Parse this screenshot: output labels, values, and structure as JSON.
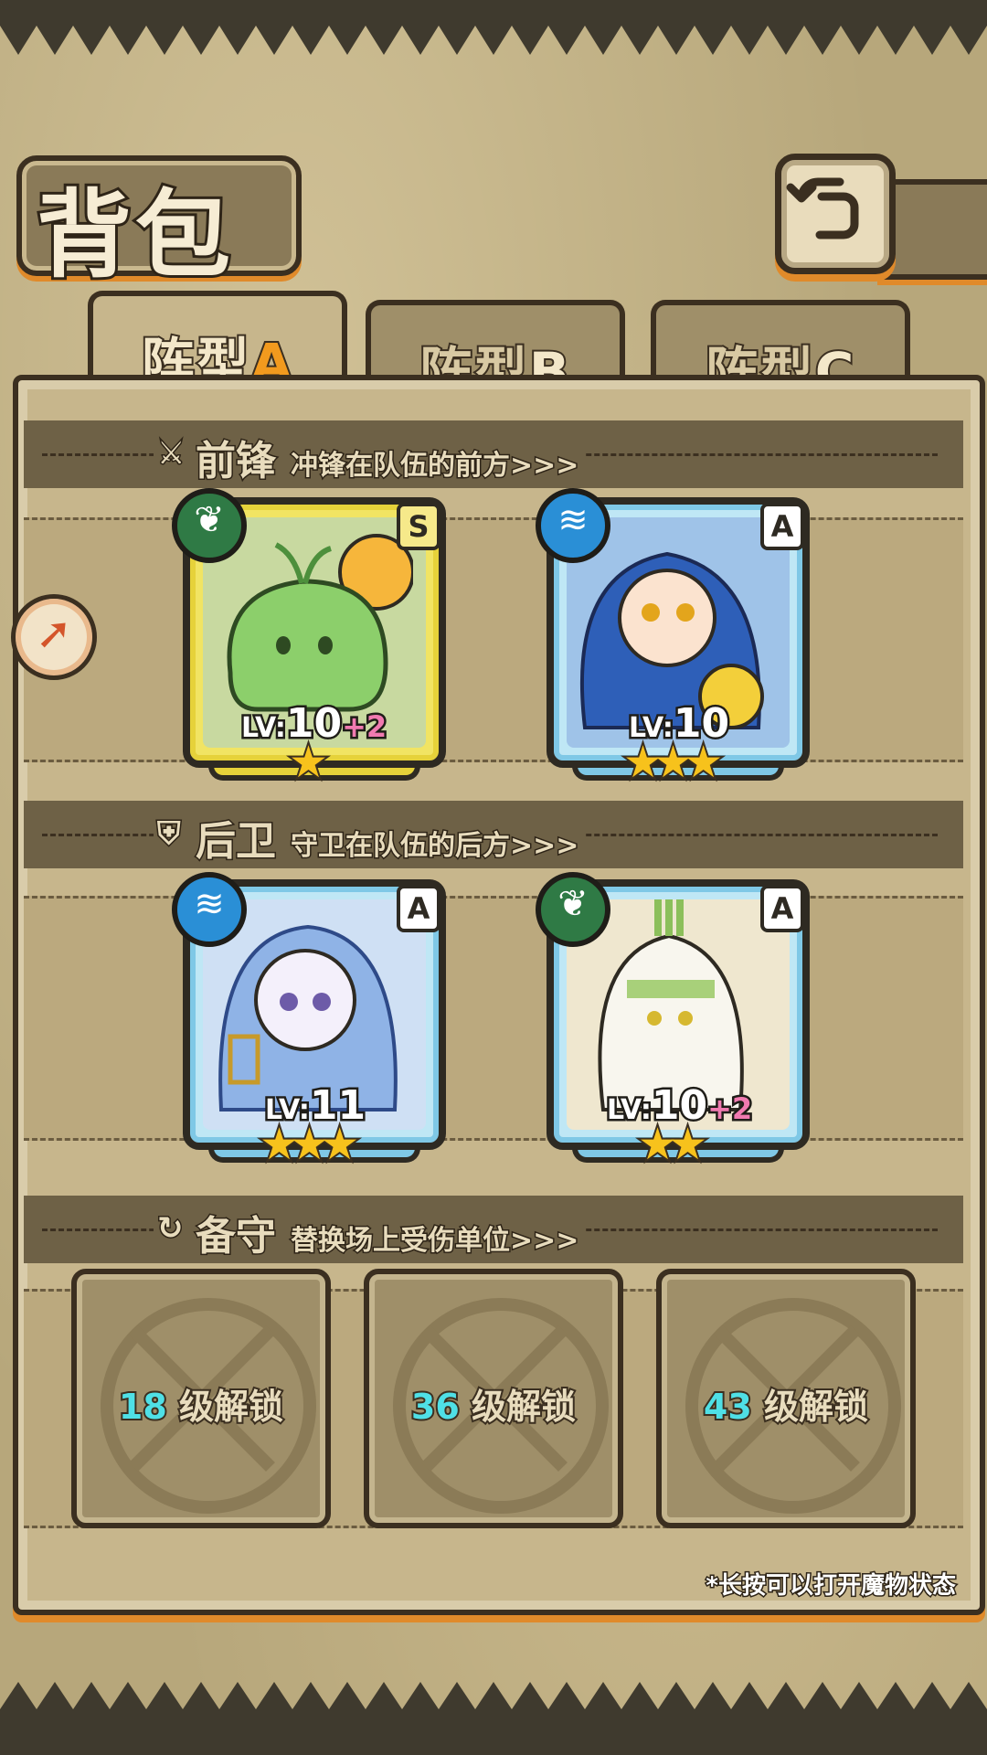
{
  "title": "背包",
  "tabs": [
    {
      "label": "阵型",
      "letter": "A",
      "active": true
    },
    {
      "label": "阵型",
      "letter": "B",
      "active": false
    },
    {
      "label": "阵型",
      "letter": "C",
      "active": false
    }
  ],
  "sections": {
    "front": {
      "title": "前锋",
      "subtitle": "冲锋在队伍的前方>>>",
      "icon": "sword-icon"
    },
    "back": {
      "title": "后卫",
      "subtitle": "守卫在队伍的后方>>>",
      "icon": "shield-icon"
    },
    "reserve": {
      "title": "备守",
      "subtitle": "替换场上受伤单位>>>",
      "icon": "swap-icon"
    }
  },
  "front_cards": [
    {
      "element": "leaf",
      "rank": "S",
      "lv_prefix": "LV:",
      "level": "10",
      "bonus": "+2",
      "stars": 1,
      "frame": "gold"
    },
    {
      "element": "water",
      "rank": "A",
      "lv_prefix": "LV:",
      "level": "10",
      "bonus": "",
      "stars": 3,
      "frame": "blue"
    }
  ],
  "back_cards": [
    {
      "element": "water",
      "rank": "A",
      "lv_prefix": "LV:",
      "level": "11",
      "bonus": "",
      "stars": 3,
      "frame": "blue"
    },
    {
      "element": "leaf",
      "rank": "A",
      "lv_prefix": "LV:",
      "level": "10",
      "bonus": "+2",
      "stars": 2,
      "frame": "blue"
    }
  ],
  "reserve_slots": [
    {
      "level": "18",
      "label": "级解锁"
    },
    {
      "level": "36",
      "label": "级解锁"
    },
    {
      "level": "43",
      "label": "级解锁"
    }
  ],
  "hint": "*长按可以打开魔物状态",
  "colors": {
    "accent": "#e08a2a",
    "frame_dark": "#3b2f20",
    "gold_frame": "#f1e463",
    "blue_frame": "#bfe7f5",
    "bonus": "#f07ab0",
    "unlock_level": "#4fe0e6"
  }
}
